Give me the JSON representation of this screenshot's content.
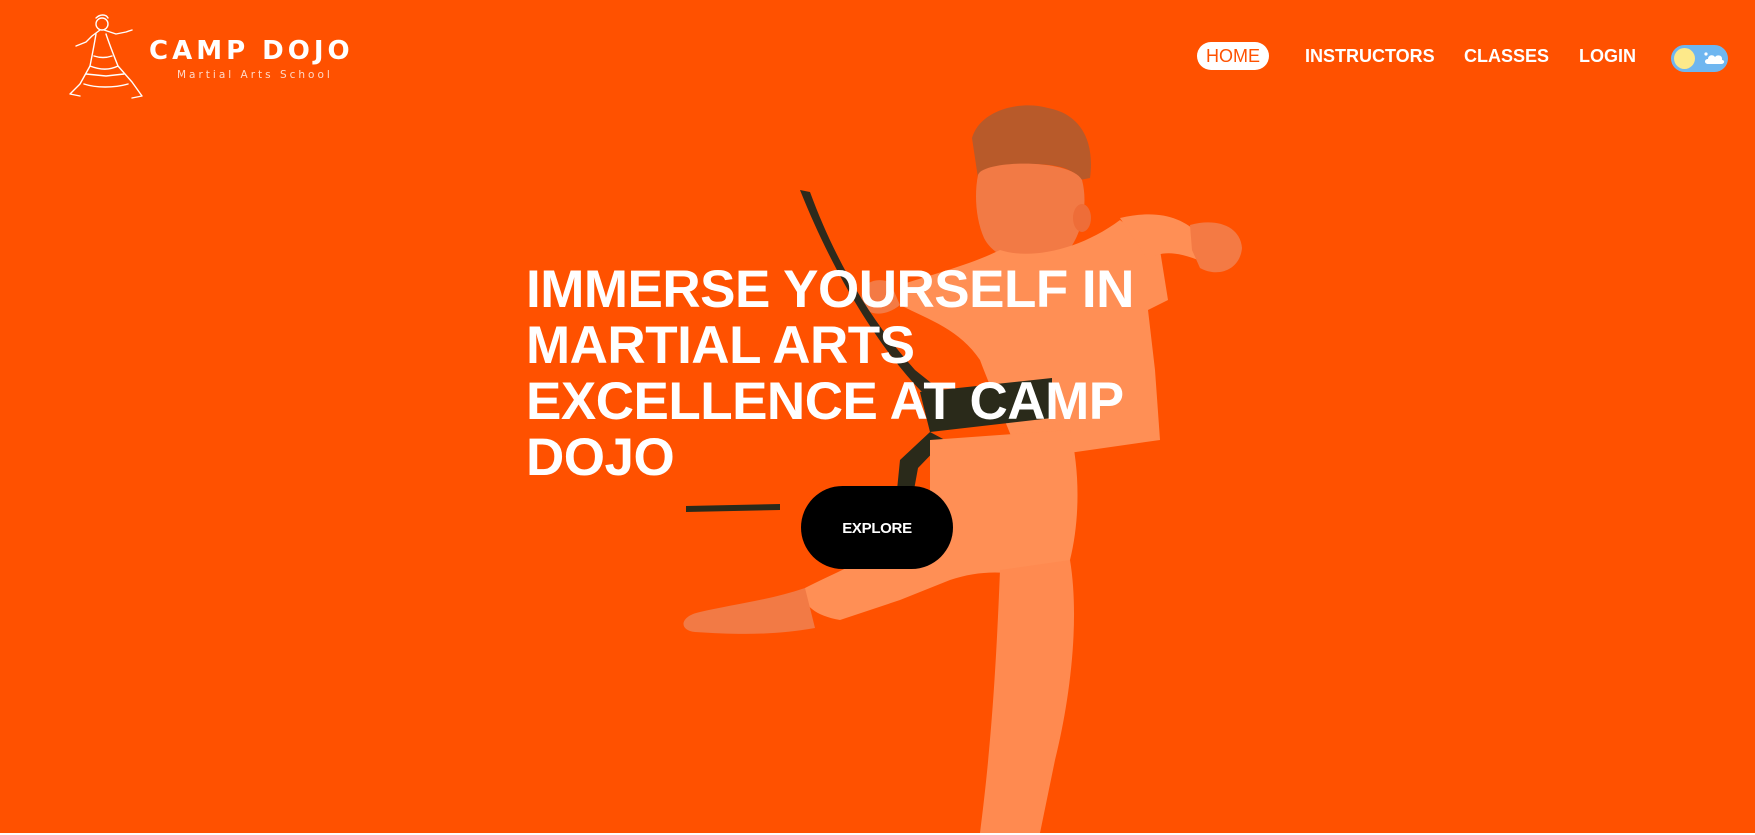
{
  "brand": {
    "name": "CAMP DOJO",
    "tagline": "Martial Arts School",
    "logo_icon": "martial-artist-line-art-icon"
  },
  "nav": {
    "items": [
      {
        "label": "HOME",
        "active": true
      },
      {
        "label": "INSTRUCTORS",
        "active": false
      },
      {
        "label": "CLASSES",
        "active": false
      },
      {
        "label": "LOGIN",
        "active": false
      }
    ],
    "theme_toggle": {
      "state": "light",
      "icons": [
        "sun-icon",
        "cloud-icon"
      ]
    }
  },
  "hero": {
    "headline": "IMMERSE YOURSELF IN MARTIAL ARTS EXCELLENCE AT CAMP DOJO",
    "cta_label": "EXPLORE",
    "image": "child-karate-kick-photo"
  },
  "colors": {
    "accent": "#ff5100",
    "button": "#000000",
    "text": "#ffffff",
    "toggle_bg": "#6fb6f0",
    "toggle_sun": "#fde98a"
  }
}
